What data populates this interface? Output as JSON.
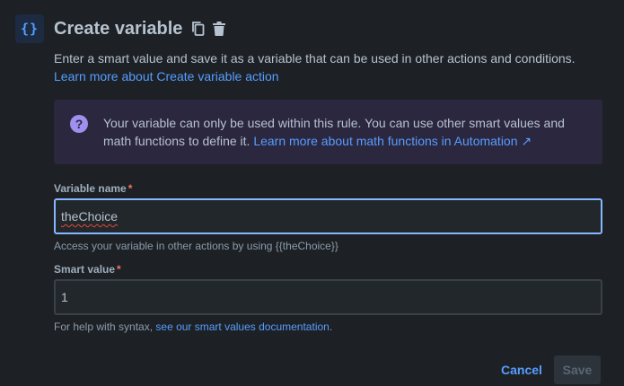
{
  "header": {
    "icon_text": "{}",
    "title": "Create variable"
  },
  "description": {
    "text": "Enter a smart value and save it as a variable that can be used in other actions and conditions. ",
    "link": "Learn more about Create variable action"
  },
  "info": {
    "text": "Your variable can only be used within this rule. You can use other smart values and math functions to define it. ",
    "link": "Learn more about math functions in Automation ↗"
  },
  "variable_name": {
    "label": "Variable name",
    "required_mark": "*",
    "value": "theChoice",
    "helper": "Access your variable in other actions by using {{theChoice}}"
  },
  "smart_value": {
    "label": "Smart value",
    "required_mark": "*",
    "value": "1",
    "helper_prefix": "For help with syntax, ",
    "helper_link": "see our smart values documentation",
    "helper_suffix": "."
  },
  "footer": {
    "cancel_label": "Cancel",
    "save_label": "Save"
  },
  "colors": {
    "background": "#1d2125",
    "text": "#b6c2cf",
    "link": "#579dff",
    "info_background": "#2b273f",
    "info_icon": "#9f8fef",
    "focus_border": "#85b8ff",
    "required": "#f87168"
  },
  "icons": {
    "action": "curly-braces-icon",
    "copy": "copy-icon",
    "delete": "trash-icon",
    "info": "question-circle-icon"
  }
}
